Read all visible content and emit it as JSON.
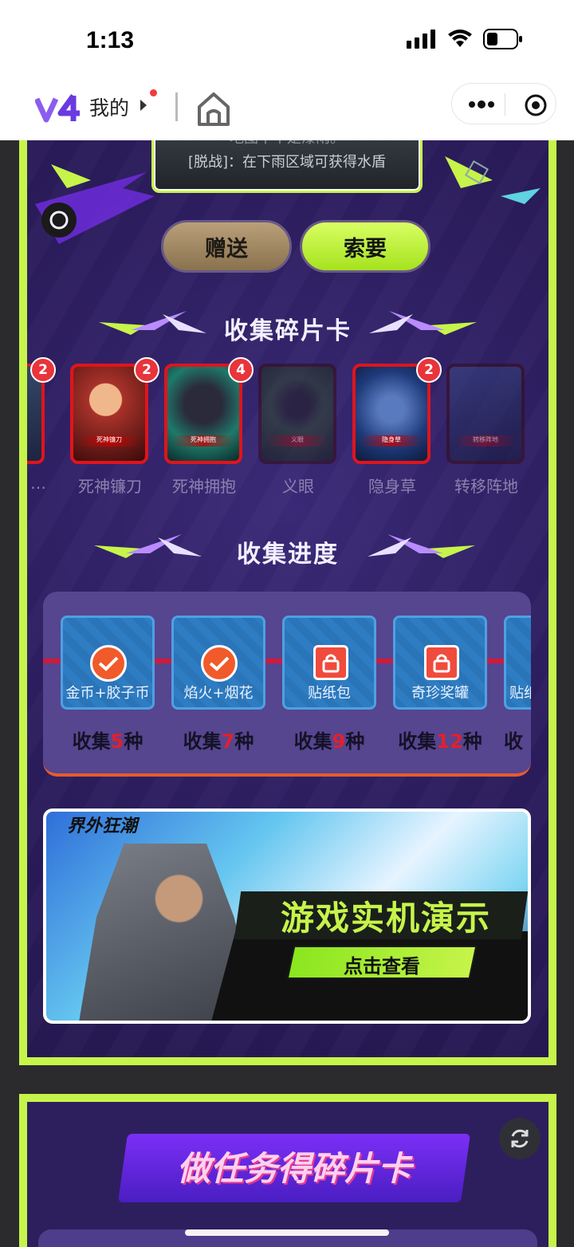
{
  "status": {
    "time": "1:13"
  },
  "nav": {
    "mine_label": "我的"
  },
  "event": {
    "line_top": "地图中个是漆雨。",
    "line_hint": "[脱战]：在下雨区域可获得水盾"
  },
  "actions": {
    "gift_label": "赠送",
    "ask_label": "索要"
  },
  "fragments": {
    "title": "收集碎片卡",
    "items": [
      {
        "name": "…",
        "card_caption": "",
        "count": "2"
      },
      {
        "name": "死神镰刀",
        "card_caption": "死神镰刀",
        "count": "2"
      },
      {
        "name": "死神拥抱",
        "card_caption": "死神拥抱",
        "count": "4"
      },
      {
        "name": "义眼",
        "card_caption": "义眼",
        "count": ""
      },
      {
        "name": "隐身草",
        "card_caption": "隐身草",
        "count": "2"
      },
      {
        "name": "转移阵地",
        "card_caption": "转移阵地",
        "count": ""
      }
    ]
  },
  "progress": {
    "title": "收集进度",
    "items": [
      {
        "reward": "金币+胶子币",
        "req_prefix": "收集",
        "req_num": "5",
        "req_suffix": "种",
        "state": "done"
      },
      {
        "reward": "焰火+烟花",
        "req_prefix": "收集",
        "req_num": "7",
        "req_suffix": "种",
        "state": "done"
      },
      {
        "reward": "贴纸包",
        "req_prefix": "收集",
        "req_num": "9",
        "req_suffix": "种",
        "state": "locked"
      },
      {
        "reward": "奇珍奖罐",
        "req_prefix": "收集",
        "req_num": "12",
        "req_suffix": "种",
        "state": "locked"
      },
      {
        "reward": "贴纸",
        "req_prefix": "收",
        "req_num": "",
        "req_suffix": "",
        "state": "locked"
      }
    ]
  },
  "banner": {
    "logo": "界外狂潮",
    "title": "游戏实机演示",
    "cta": "点击查看"
  },
  "tasks": {
    "title": "做任务得碎片卡"
  },
  "colors": {
    "accent": "#c6f44a",
    "panel": "#2d1f5e",
    "badge": "#e8343a"
  }
}
